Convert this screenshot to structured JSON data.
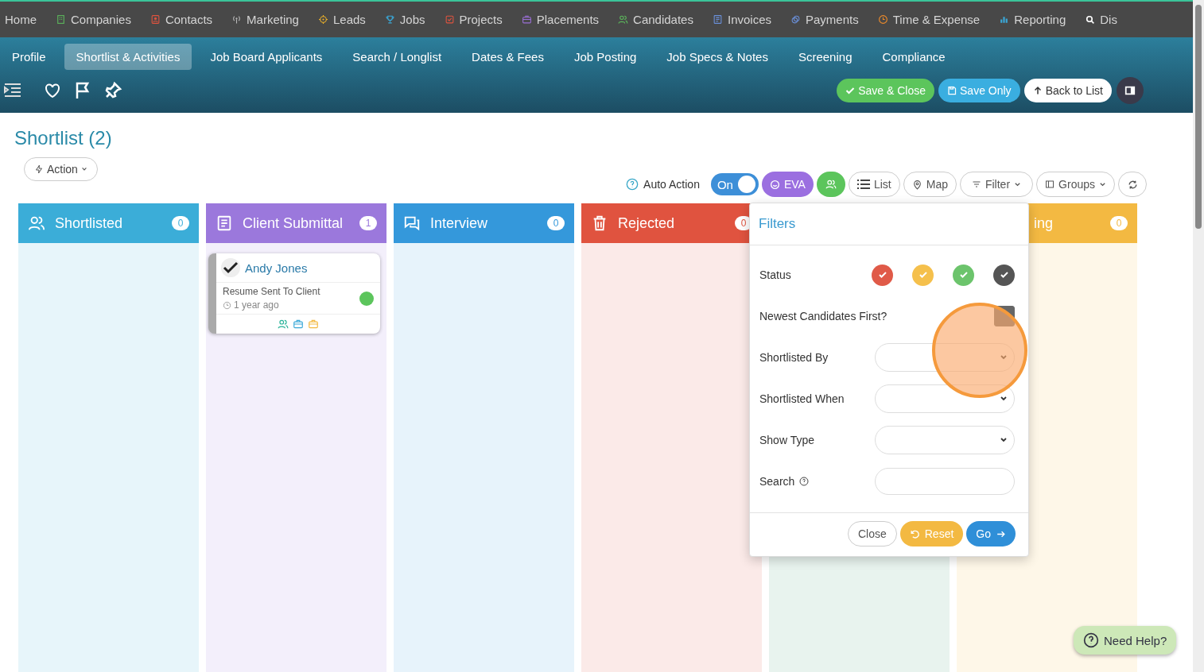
{
  "top_nav": [
    {
      "label": "Home"
    },
    {
      "label": "Companies"
    },
    {
      "label": "Contacts"
    },
    {
      "label": "Marketing"
    },
    {
      "label": "Leads"
    },
    {
      "label": "Jobs"
    },
    {
      "label": "Projects"
    },
    {
      "label": "Placements"
    },
    {
      "label": "Candidates"
    },
    {
      "label": "Invoices"
    },
    {
      "label": "Payments"
    },
    {
      "label": "Time & Expense"
    },
    {
      "label": "Reporting"
    },
    {
      "label": "Dis"
    }
  ],
  "tabs": [
    {
      "label": "Profile",
      "selected": false
    },
    {
      "label": "Shortlist & Activities",
      "selected": true
    },
    {
      "label": "Job Board Applicants",
      "selected": false
    },
    {
      "label": "Search / Longlist",
      "selected": false
    },
    {
      "label": "Dates & Fees",
      "selected": false
    },
    {
      "label": "Job Posting",
      "selected": false
    },
    {
      "label": "Job Specs & Notes",
      "selected": false
    },
    {
      "label": "Screening",
      "selected": false
    },
    {
      "label": "Compliance",
      "selected": false
    }
  ],
  "header_buttons": [
    {
      "label": "Save & Close",
      "kind": "save-close"
    },
    {
      "label": "Save Only",
      "kind": "save"
    },
    {
      "label": "Back to List",
      "kind": "back"
    }
  ],
  "page_title": "Shortlist (2)",
  "action_button": "Action",
  "toolbar": {
    "auto_action": "Auto Action",
    "toggle": {
      "label": "On",
      "on": true
    },
    "eva": "EVA",
    "list": "List",
    "map": "Map",
    "filter": "Filter",
    "groups": "Groups"
  },
  "columns": [
    {
      "title": "Shortlisted",
      "count": "0",
      "color": "#3badd8"
    },
    {
      "title": "Client Submittal",
      "count": "1",
      "color": "#9b78dc",
      "cards": [
        {
          "name": "Andy Jones",
          "status": "Resume Sent To Client",
          "time": "1 year ago",
          "color": "#5cc55c"
        }
      ]
    },
    {
      "title": "Interview",
      "count": "0",
      "color": "#3498db"
    },
    {
      "title": "Rejected",
      "count": "0",
      "color": "#e0533f"
    },
    {
      "color": "#e8f3ee"
    },
    {
      "title": "ing",
      "count": "0",
      "color": "#f3b942"
    }
  ],
  "filters": {
    "title": "Filters",
    "status_label": "Status",
    "status": [
      {
        "color": "#e05a48"
      },
      {
        "color": "#f5c04c"
      },
      {
        "color": "#6cc46c"
      },
      {
        "color": "#555555"
      }
    ],
    "newest_label": "Newest Candidates First?",
    "newest_checked": true,
    "selects": [
      {
        "label": "Shortlisted By"
      },
      {
        "label": "Shortlisted When"
      },
      {
        "label": "Show Type"
      }
    ],
    "search_label": "Search",
    "buttons": {
      "close": "Close",
      "reset": "Reset",
      "go": "Go"
    }
  },
  "help_button": "Need Help?"
}
